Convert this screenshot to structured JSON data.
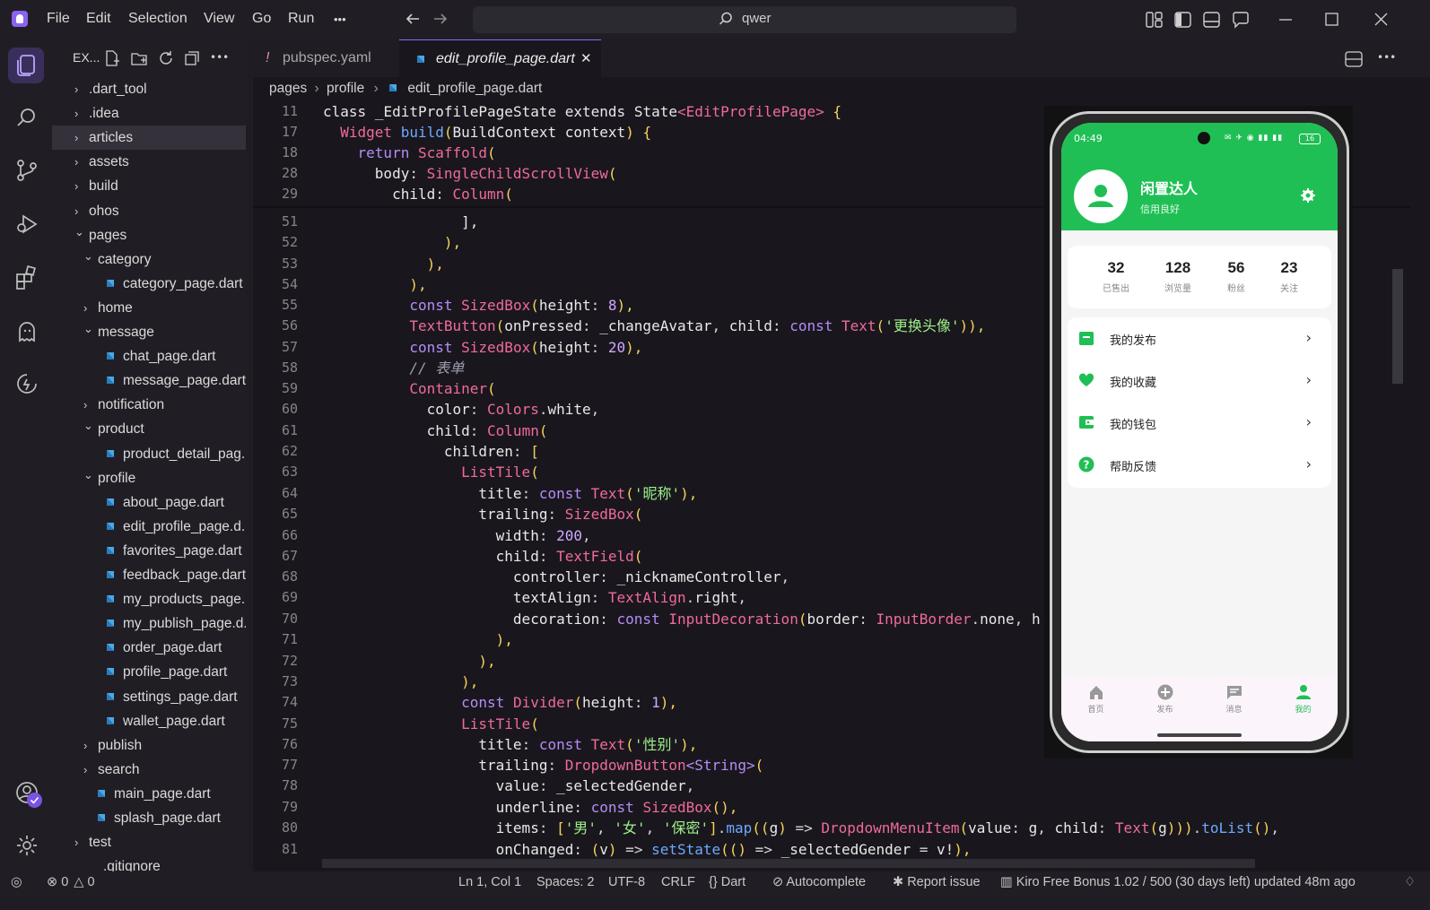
{
  "menu": {
    "file": "File",
    "edit": "Edit",
    "selection": "Selection",
    "view": "View",
    "go": "Go",
    "run": "Run",
    "more": "•••"
  },
  "search": {
    "label": "qwer"
  },
  "explorer": {
    "title": "EX...",
    "items": [
      {
        "label": ".dart_tool",
        "type": "folder",
        "open": false,
        "depth": 0
      },
      {
        "label": ".idea",
        "type": "folder",
        "open": false,
        "depth": 0
      },
      {
        "label": "articles",
        "type": "folder",
        "open": false,
        "depth": 0,
        "selected": true
      },
      {
        "label": "assets",
        "type": "folder",
        "open": false,
        "depth": 0
      },
      {
        "label": "build",
        "type": "folder",
        "open": false,
        "depth": 0
      },
      {
        "label": "ohos",
        "type": "folder",
        "open": false,
        "depth": 0
      },
      {
        "label": "pages",
        "type": "folder",
        "open": true,
        "depth": 0
      },
      {
        "label": "category",
        "type": "folder",
        "open": true,
        "depth": 1
      },
      {
        "label": "category_page.dart",
        "type": "file",
        "depth": 2
      },
      {
        "label": "home",
        "type": "folder",
        "open": false,
        "depth": 1
      },
      {
        "label": "message",
        "type": "folder",
        "open": true,
        "depth": 1
      },
      {
        "label": "chat_page.dart",
        "type": "file",
        "depth": 2
      },
      {
        "label": "message_page.dart",
        "type": "file",
        "depth": 2
      },
      {
        "label": "notification",
        "type": "folder",
        "open": false,
        "depth": 1
      },
      {
        "label": "product",
        "type": "folder",
        "open": true,
        "depth": 1
      },
      {
        "label": "product_detail_pag...",
        "type": "file",
        "depth": 2
      },
      {
        "label": "profile",
        "type": "folder",
        "open": true,
        "depth": 1
      },
      {
        "label": "about_page.dart",
        "type": "file",
        "depth": 2
      },
      {
        "label": "edit_profile_page.d...",
        "type": "file",
        "depth": 2
      },
      {
        "label": "favorites_page.dart",
        "type": "file",
        "depth": 2
      },
      {
        "label": "feedback_page.dart",
        "type": "file",
        "depth": 2
      },
      {
        "label": "my_products_page...",
        "type": "file",
        "depth": 2
      },
      {
        "label": "my_publish_page.d...",
        "type": "file",
        "depth": 2
      },
      {
        "label": "order_page.dart",
        "type": "file",
        "depth": 2
      },
      {
        "label": "profile_page.dart",
        "type": "file",
        "depth": 2
      },
      {
        "label": "settings_page.dart",
        "type": "file",
        "depth": 2
      },
      {
        "label": "wallet_page.dart",
        "type": "file",
        "depth": 2
      },
      {
        "label": "publish",
        "type": "folder",
        "open": false,
        "depth": 1
      },
      {
        "label": "search",
        "type": "folder",
        "open": false,
        "depth": 1
      },
      {
        "label": "main_page.dart",
        "type": "file",
        "depth": 1
      },
      {
        "label": "splash_page.dart",
        "type": "file",
        "depth": 1
      },
      {
        "label": "test",
        "type": "folder",
        "open": false,
        "depth": 0
      },
      {
        "label": ".gitignore",
        "type": "plain",
        "depth": 1
      }
    ]
  },
  "tabs": [
    {
      "label": "pubspec.yaml",
      "active": false,
      "icon": "!"
    },
    {
      "label": "edit_profile_page.dart",
      "active": true
    }
  ],
  "breadcrumb": {
    "a": "pages",
    "b": "profile",
    "c": "edit_profile_page.dart"
  },
  "code": [
    {
      "n": "11",
      "html": "<span class='kw'>class</span> <span class='pr'>_EditProfilePageState</span> <span class='kw'>extends</span> <span class='pr'>State</span><span class='ty'>&lt;EditProfilePage&gt;</span> <span class='yl'>{</span>"
    },
    {
      "n": "17",
      "html": "  <span class='ty'>Widget</span> <span class='fn'>build</span><span class='yl'>(</span><span class='pr'>BuildContext</span> <span class='pr'>context</span><span class='yl'>)</span> <span class='yl'>{</span>"
    },
    {
      "n": "18",
      "html": "    <span class='k2'>return</span> <span class='ty'>Scaffold</span><span class='yl'>(</span>"
    },
    {
      "n": "28",
      "html": "      <span class='pr'>body</span>: <span class='ty'>SingleChildScrollView</span><span class='yl'>(</span>"
    },
    {
      "n": "29",
      "html": "        <span class='pr'>child</span>: <span class='ty'>Column</span><span class='yl'>(</span>"
    },
    {
      "n": "51",
      "html": "                <span class='pr'>],</span>"
    },
    {
      "n": "52",
      "html": "              <span class='yl'>),</span>"
    },
    {
      "n": "53",
      "html": "            <span class='yl'>),</span>"
    },
    {
      "n": "54",
      "html": "          <span class='yl'>),</span>"
    },
    {
      "n": "55",
      "html": "          <span class='k2'>const</span> <span class='ty'>SizedBox</span><span class='yl'>(</span><span class='pr'>height</span>: <span class='nm'>8</span><span class='yl'>),</span>"
    },
    {
      "n": "56",
      "html": "          <span class='ty'>TextButton</span><span class='yl'>(</span><span class='pr'>onPressed</span>: <span class='pr'>_changeAvatar</span>, <span class='pr'>child</span>: <span class='k2'>const</span> <span class='ty'>Text</span><span class='yl'>(</span><span class='st'>'更换头像'</span><span class='yl'>)),</span>"
    },
    {
      "n": "57",
      "html": "          <span class='k2'>const</span> <span class='ty'>SizedBox</span><span class='yl'>(</span><span class='pr'>height</span>: <span class='nm'>20</span><span class='yl'>),</span>"
    },
    {
      "n": "58",
      "html": "          <span class='cm'>// 表单</span>"
    },
    {
      "n": "59",
      "html": "          <span class='ty'>Container</span><span class='yl'>(</span>"
    },
    {
      "n": "60",
      "html": "            <span class='pr'>color</span>: <span class='ty'>Colors</span>.<span class='pr'>white</span>,"
    },
    {
      "n": "61",
      "html": "            <span class='pr'>child</span>: <span class='ty'>Column</span><span class='yl'>(</span>"
    },
    {
      "n": "62",
      "html": "              <span class='pr'>children</span>: <span class='yl'>[</span>"
    },
    {
      "n": "63",
      "html": "                <span class='ty'>ListTile</span><span class='yl'>(</span>"
    },
    {
      "n": "64",
      "html": "                  <span class='pr'>title</span>: <span class='k2'>const</span> <span class='ty'>Text</span><span class='yl'>(</span><span class='st'>'昵称'</span><span class='yl'>),</span>"
    },
    {
      "n": "65",
      "html": "                  <span class='pr'>trailing</span>: <span class='ty'>SizedBox</span><span class='yl'>(</span>"
    },
    {
      "n": "66",
      "html": "                    <span class='pr'>width</span>: <span class='nm'>200</span>,"
    },
    {
      "n": "67",
      "html": "                    <span class='pr'>child</span>: <span class='ty'>TextField</span><span class='yl'>(</span>"
    },
    {
      "n": "68",
      "html": "                      <span class='pr'>controller</span>: <span class='pr'>_nicknameController</span>,"
    },
    {
      "n": "69",
      "html": "                      <span class='pr'>textAlign</span>: <span class='ty'>TextAlign</span>.<span class='pr'>right</span>,"
    },
    {
      "n": "70",
      "html": "                      <span class='pr'>decoration</span>: <span class='k2'>const</span> <span class='ty'>InputDecoration</span><span class='yl'>(</span><span class='pr'>border</span>: <span class='ty'>InputBorder</span>.<span class='pr'>none</span>, <span class='pr'>h</span>"
    },
    {
      "n": "71",
      "html": "                    <span class='yl'>),</span>"
    },
    {
      "n": "72",
      "html": "                  <span class='yl'>),</span>"
    },
    {
      "n": "73",
      "html": "                <span class='yl'>),</span>"
    },
    {
      "n": "74",
      "html": "                <span class='k2'>const</span> <span class='ty'>Divider</span><span class='yl'>(</span><span class='pr'>height</span>: <span class='nm'>1</span><span class='yl'>),</span>"
    },
    {
      "n": "75",
      "html": "                <span class='ty'>ListTile</span><span class='yl'>(</span>"
    },
    {
      "n": "76",
      "html": "                  <span class='pr'>title</span>: <span class='k2'>const</span> <span class='ty'>Text</span><span class='yl'>(</span><span class='st'>'性别'</span><span class='yl'>),</span>"
    },
    {
      "n": "77",
      "html": "                  <span class='pr'>trailing</span>: <span class='ty'>DropdownButton</span><span class='k2'>&lt;String&gt;</span><span class='yl'>(</span>"
    },
    {
      "n": "78",
      "html": "                    <span class='pr'>value</span>: <span class='pr'>_selectedGender</span>,"
    },
    {
      "n": "79",
      "html": "                    <span class='pr'>underline</span>: <span class='k2'>const</span> <span class='ty'>SizedBox</span><span class='yl'>(),</span>"
    },
    {
      "n": "80",
      "html": "                    <span class='pr'>items</span>: <span class='yl'>[</span><span class='st'>'男'</span>, <span class='st'>'女'</span>, <span class='st'>'保密'</span><span class='yl'>]</span>.<span class='fn'>map</span><span class='yl'>((</span><span class='pr'>g</span><span class='yl'>)</span> =&gt; <span class='ty'>DropdownMenuItem</span><span class='yl'>(</span><span class='pr'>value</span>: <span class='pr'>g</span>, <span class='pr'>child</span>: <span class='ty'>Text</span><span class='yl'>(</span><span class='pr'>g</span><span class='yl'>)))</span>.<span class='fn'>toList</span><span class='yl'>()</span>,"
    },
    {
      "n": "81",
      "html": "                    <span class='pr'>onChanged</span>: <span class='yl'>(</span><span class='pr'>v</span><span class='yl'>)</span> =&gt; <span class='fn'>setState</span><span class='yl'>(()</span> =&gt; <span class='pr'>_selectedGender</span> = <span class='pr'>v!</span><span class='yl'>),</span>"
    }
  ],
  "status": {
    "errors": "0",
    "warnings": "0",
    "position": "Ln 1, Col 1",
    "spaces": "Spaces: 2",
    "encoding": "UTF-8",
    "eol": "CRLF",
    "lang": "Dart",
    "autocomplete": "Autocomplete",
    "report": "Report issue",
    "kiro": "Kiro Free Bonus 1.02 / 500 (30 days left) updated 48m ago"
  },
  "phone": {
    "time": "04:49",
    "battery": "16",
    "username": "闲置达人",
    "subtitle": "信用良好",
    "stats": [
      {
        "value": "32",
        "label": "已售出"
      },
      {
        "value": "128",
        "label": "浏览量"
      },
      {
        "value": "56",
        "label": "粉丝"
      },
      {
        "value": "23",
        "label": "关注"
      }
    ],
    "menu": [
      {
        "label": "我的发布",
        "icon": "store-icon"
      },
      {
        "label": "我的收藏",
        "icon": "heart-icon"
      },
      {
        "label": "我的钱包",
        "icon": "wallet-icon"
      },
      {
        "label": "帮助反馈",
        "icon": "help-icon"
      }
    ],
    "nav": [
      {
        "label": "首页",
        "icon": "home-icon"
      },
      {
        "label": "发布",
        "icon": "add-circle-icon"
      },
      {
        "label": "消息",
        "icon": "message-icon"
      },
      {
        "label": "我的",
        "icon": "person-icon",
        "active": true
      }
    ],
    "accent": "#20bf55"
  }
}
